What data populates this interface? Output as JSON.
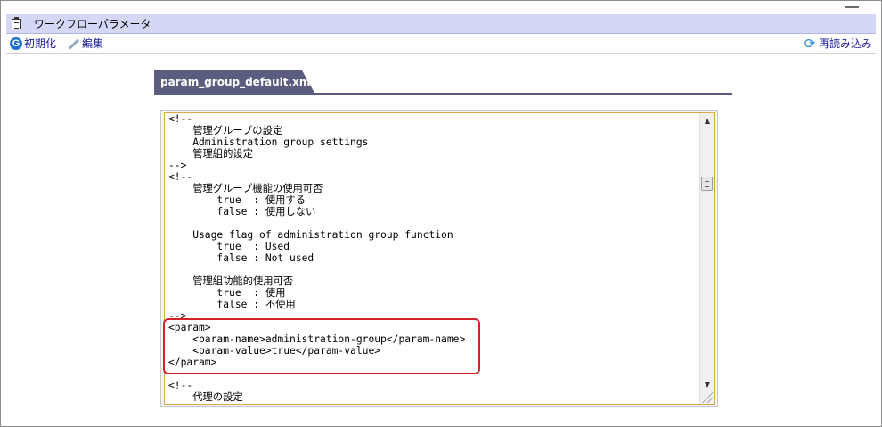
{
  "header": {
    "title": "ワークフローパラメータ"
  },
  "toolbar": {
    "init_label": "初期化",
    "edit_label": "編集",
    "reload_label": "再読み込み"
  },
  "tabs": [
    {
      "label": "param_group_default.xml"
    }
  ],
  "editor": {
    "content": "<!--\n    管理グループの設定\n    Administration group settings\n    管理組的设定\n-->\n<!--\n    管理グループ機能の使用可否\n        true  : 使用する\n        false : 使用しない\n\n    Usage flag of administration group function\n        true  : Used\n        false : Not used\n\n    管理組功能的使用可否\n        true  : 使用\n        false : 不使用\n-->\n<param>\n    <param-name>administration-group</param-name>\n    <param-value>true</param-value>\n</param>\n\n<!--\n    代理の設定"
  },
  "colors": {
    "title_bar": "#d4d7f5",
    "tab": "#5a5d80",
    "highlight": "#d0232a",
    "editor_border": "#d9a84a"
  },
  "icons": {
    "title": "clipboard-icon",
    "init": "g-circle-icon",
    "edit": "pencil-icon",
    "reload": "reload-icon"
  }
}
